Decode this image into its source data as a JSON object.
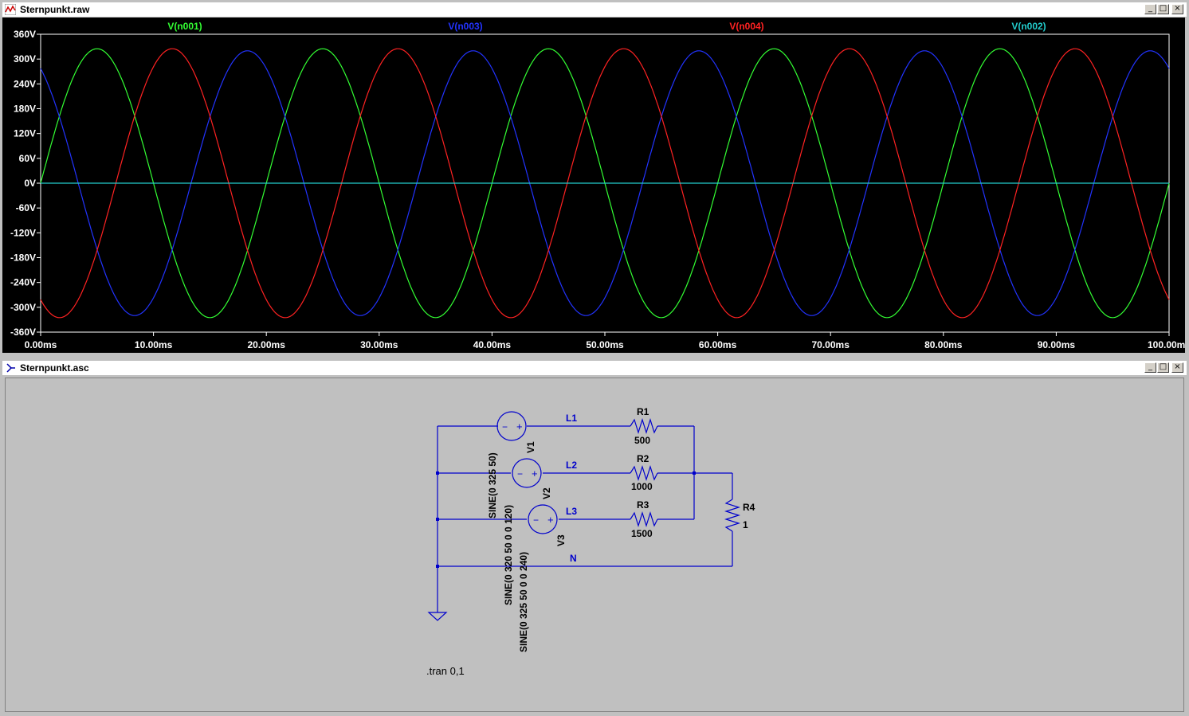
{
  "plot_window": {
    "title": "Sternpunkt.raw",
    "controls": {
      "minimize": "_",
      "maximize": "□",
      "close": "×"
    }
  },
  "schematic_window": {
    "title": "Sternpunkt.asc",
    "controls": {
      "minimize": "_",
      "maximize": "□",
      "close": "×"
    }
  },
  "colors": {
    "plot_background": "#000000",
    "v_n001": "#33ff33",
    "v_n003": "#2233ff",
    "v_n004": "#ff2222",
    "v_n002": "#22cccc",
    "axis_text": "#ffffff",
    "schematic_wire": "#0000cc",
    "schematic_background": "#c0c0c0"
  },
  "chart_data": {
    "type": "line",
    "xlabel": "",
    "ylabel": "",
    "xlim": [
      0,
      100
    ],
    "ylim": [
      -360,
      360
    ],
    "x_unit": "ms",
    "y_unit": "V",
    "x_ticks": [
      "0.00ms",
      "10.00ms",
      "20.00ms",
      "30.00ms",
      "40.00ms",
      "50.00ms",
      "60.00ms",
      "70.00ms",
      "80.00ms",
      "90.00ms",
      "100.00ms"
    ],
    "y_ticks": [
      "360V",
      "300V",
      "240V",
      "180V",
      "120V",
      "60V",
      "0V",
      "-60V",
      "-120V",
      "-180V",
      "-240V",
      "-300V",
      "-360V"
    ],
    "series": [
      {
        "name": "V(n001)",
        "amplitude": 325,
        "frequency_hz": 50,
        "phase_deg": 0
      },
      {
        "name": "V(n003)",
        "amplitude": 320,
        "frequency_hz": 50,
        "phase_deg": 120
      },
      {
        "name": "V(n004)",
        "amplitude": 325,
        "frequency_hz": 50,
        "phase_deg": 240
      },
      {
        "name": "V(n002)",
        "amplitude": 0,
        "frequency_hz": 50,
        "phase_deg": 0
      }
    ]
  },
  "schematic": {
    "nets": {
      "l1": "L1",
      "l2": "L2",
      "l3": "L3",
      "n": "N"
    },
    "sources": [
      {
        "name": "V1",
        "value": "SINE(0 325 50)"
      },
      {
        "name": "V2",
        "value": "SINE(0 320 50 0 0 120)"
      },
      {
        "name": "V3",
        "value": "SINE(0 325 50 0 0 240)"
      }
    ],
    "resistors": [
      {
        "name": "R1",
        "value": "500"
      },
      {
        "name": "R2",
        "value": "1000"
      },
      {
        "name": "R3",
        "value": "1500"
      },
      {
        "name": "R4",
        "value": "1"
      }
    ],
    "directive": ".tran 0,1",
    "source_minus": "−",
    "source_plus": "+"
  }
}
